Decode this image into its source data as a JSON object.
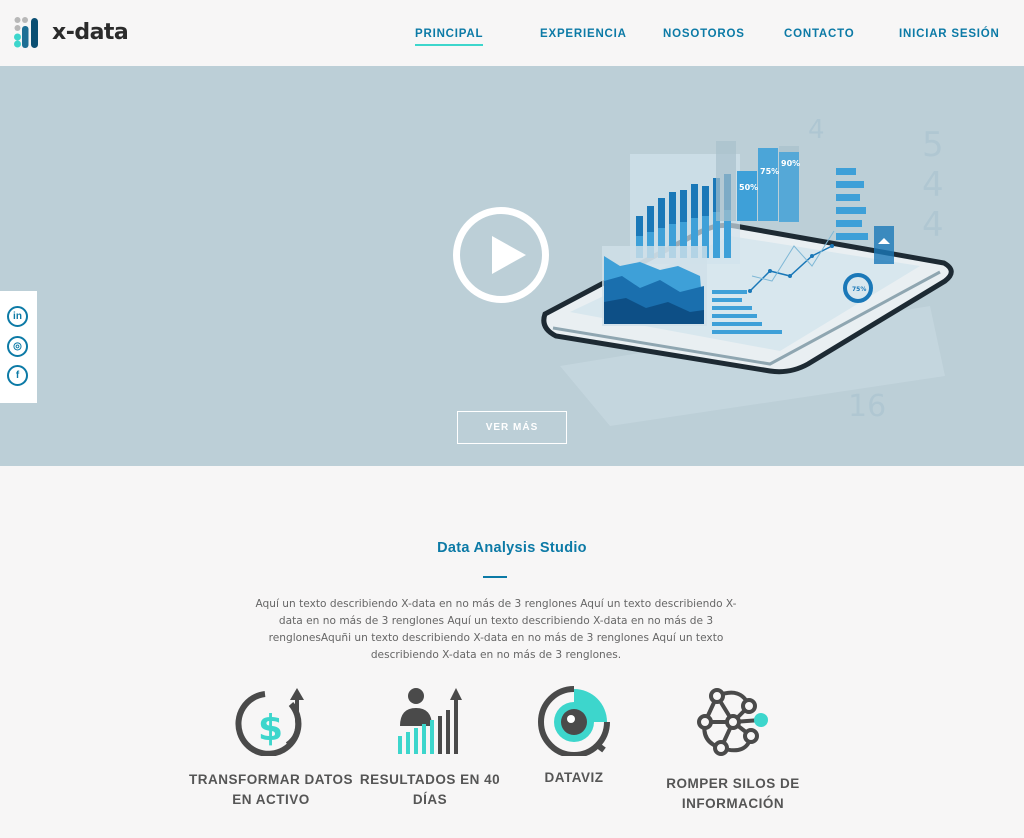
{
  "brand": {
    "name": "x-data"
  },
  "nav": {
    "items": [
      {
        "label": "PRINCIPAL",
        "active": true
      },
      {
        "label": "EXPERIENCIA",
        "active": false
      },
      {
        "label": "NOSOTOROS",
        "active": false
      },
      {
        "label": "CONTACTO",
        "active": false
      },
      {
        "label": "INICIAR SESIÓN",
        "active": false
      }
    ]
  },
  "hero": {
    "cta_label": "VER MÁS",
    "illustration": {
      "percent_labels": [
        "50%",
        "75%",
        "90%",
        "75%"
      ]
    }
  },
  "social": {
    "icons": [
      "linkedin-icon",
      "instagram-icon",
      "facebook-icon"
    ],
    "glyphs": [
      "in",
      "◎",
      "f"
    ]
  },
  "about": {
    "title": "Data Analysis Studio",
    "description": "Aquí un texto describiendo X-data en no más de 3 renglones Aquí un texto describiendo X-data en no más de 3 renglones Aquí un texto describiendo X-data en no más de 3 renglonesAquñi un texto describiendo X-data en no más de 3 renglones Aquí un texto describiendo X-data en no más de 3 renglones."
  },
  "features": [
    {
      "label": "TRANSFORMAR DATOS EN ACTIVO",
      "icon": "dollar-growth-icon"
    },
    {
      "label": "RESULTADOS EN 40 DÍAS",
      "icon": "person-chart-icon"
    },
    {
      "label": "DATAVIZ",
      "icon": "dataviz-chart-icon"
    },
    {
      "label": "ROMPER SILOS DE INFORMACIÓN",
      "icon": "network-nodes-icon"
    }
  ],
  "colors": {
    "accent": "#0c7aa6",
    "teal": "#3dd6cc",
    "hero_bg": "#bccfd7",
    "page_bg": "#f7f6f6",
    "icon_dark": "#4a4a4a"
  }
}
